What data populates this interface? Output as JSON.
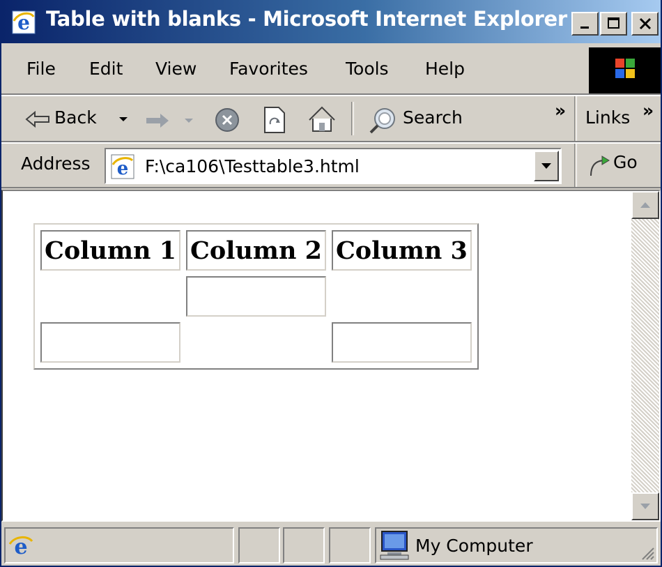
{
  "window": {
    "title": "Table with blanks - Microsoft Internet Explorer"
  },
  "menu": [
    "File",
    "Edit",
    "View",
    "Favorites",
    "Tools",
    "Help"
  ],
  "toolbar": {
    "back_label": "Back",
    "search_label": "Search",
    "links_label": "Links",
    "chevron": "»"
  },
  "address": {
    "label": "Address",
    "value": "F:\\ca106\\Testtable3.html",
    "go_label": "Go"
  },
  "table": {
    "headers": [
      "Column 1",
      "Column 2",
      "Column 3"
    ],
    "rows": [
      [
        "",
        "",
        ""
      ],
      [
        "",
        "",
        ""
      ]
    ]
  },
  "status": {
    "zone": "My Computer"
  },
  "icons": [
    "ie-logo-icon",
    "minimize-icon",
    "maximize-icon",
    "close-icon",
    "back-arrow-icon",
    "forward-arrow-icon",
    "stop-icon",
    "refresh-icon",
    "home-icon",
    "search-icon",
    "page-icon",
    "go-icon",
    "computer-icon"
  ],
  "colors": {
    "title_start": "#0a246a",
    "title_end": "#a6caf0",
    "chrome": "#d4d0c8"
  }
}
